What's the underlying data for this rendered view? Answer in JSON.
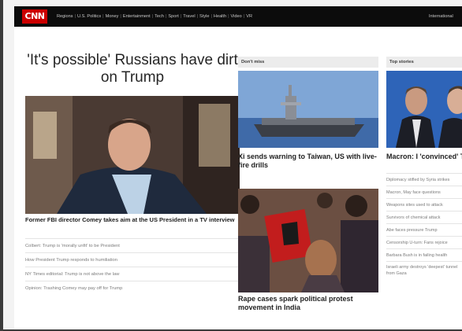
{
  "nav": {
    "logo": "CNN",
    "items": [
      "Regions",
      "U.S. Politics",
      "Money",
      "Entertainment",
      "Tech",
      "Sport",
      "Travel",
      "Style",
      "Health",
      "Video",
      "VR"
    ],
    "right": "International"
  },
  "main": {
    "headline": "'It's possible' Russians have dirt on Trump",
    "caption": "Former FBI director Comey takes aim at the US President in a TV interview",
    "links": [
      "Colbert: Trump is 'morally unfit' to be President",
      "How President Trump responds to humiliation",
      "NY Times editorial: Trump is not above the law",
      "Opinion: Trashing Comey may pay off for Trump"
    ]
  },
  "dont_miss": {
    "heading": "Don't miss",
    "story1": "Xi sends warning to Taiwan, US with live-fire drills",
    "story2": "Rape cases spark political protest movement in India"
  },
  "top_stories": {
    "heading": "Top stories",
    "title": "Macron: I 'convinced' Trump to stay in Syria",
    "items": [
      "Diplomacy stifled by Syria strikes",
      "Macron, May face questions",
      "Weapons sites used to attack",
      "Survivors of chemical attack",
      "Abe faces pressure Trump",
      "Censorship U-turn: Fans rejoice",
      "Barbara Bush is in failing health"
    ],
    "last": "Israeli army destroys 'deepest' tunnel from Gaza"
  }
}
